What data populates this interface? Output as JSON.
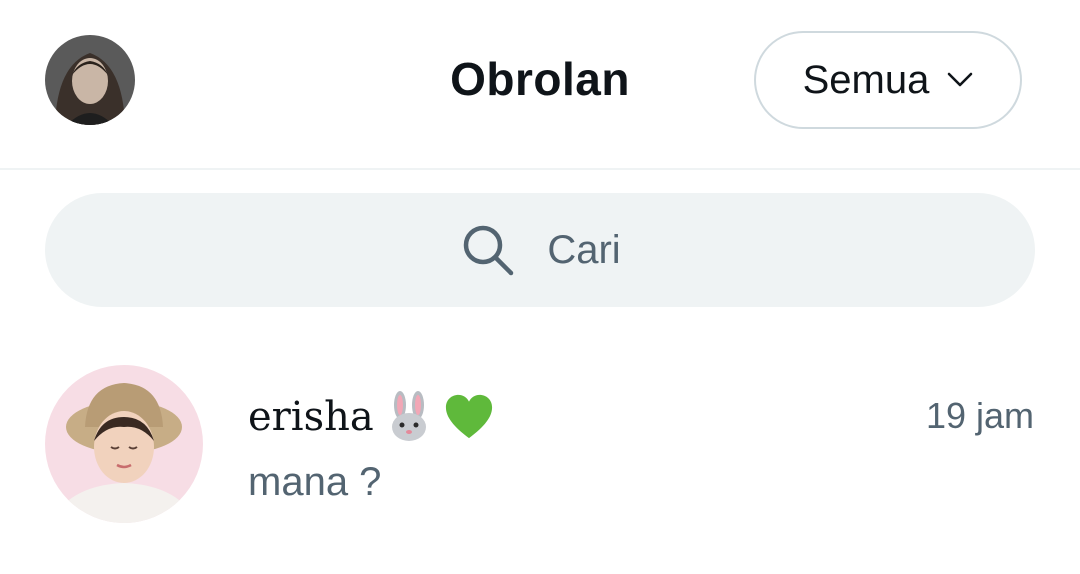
{
  "header": {
    "title": "Obrolan",
    "filter_label": "Semua",
    "filter_icon": "chevron-down-icon",
    "profile_avatar": "user-avatar"
  },
  "search": {
    "placeholder": "Cari",
    "icon": "search-icon"
  },
  "conversations": [
    {
      "name": "erisha",
      "emojis": [
        "rabbit-face-emoji",
        "green-heart-emoji"
      ],
      "time": "19 jam",
      "preview": "mana ?"
    }
  ],
  "colors": {
    "text_primary": "#0f1419",
    "text_secondary": "#536471",
    "search_bg": "#eff3f4",
    "border": "#cfd9de"
  }
}
